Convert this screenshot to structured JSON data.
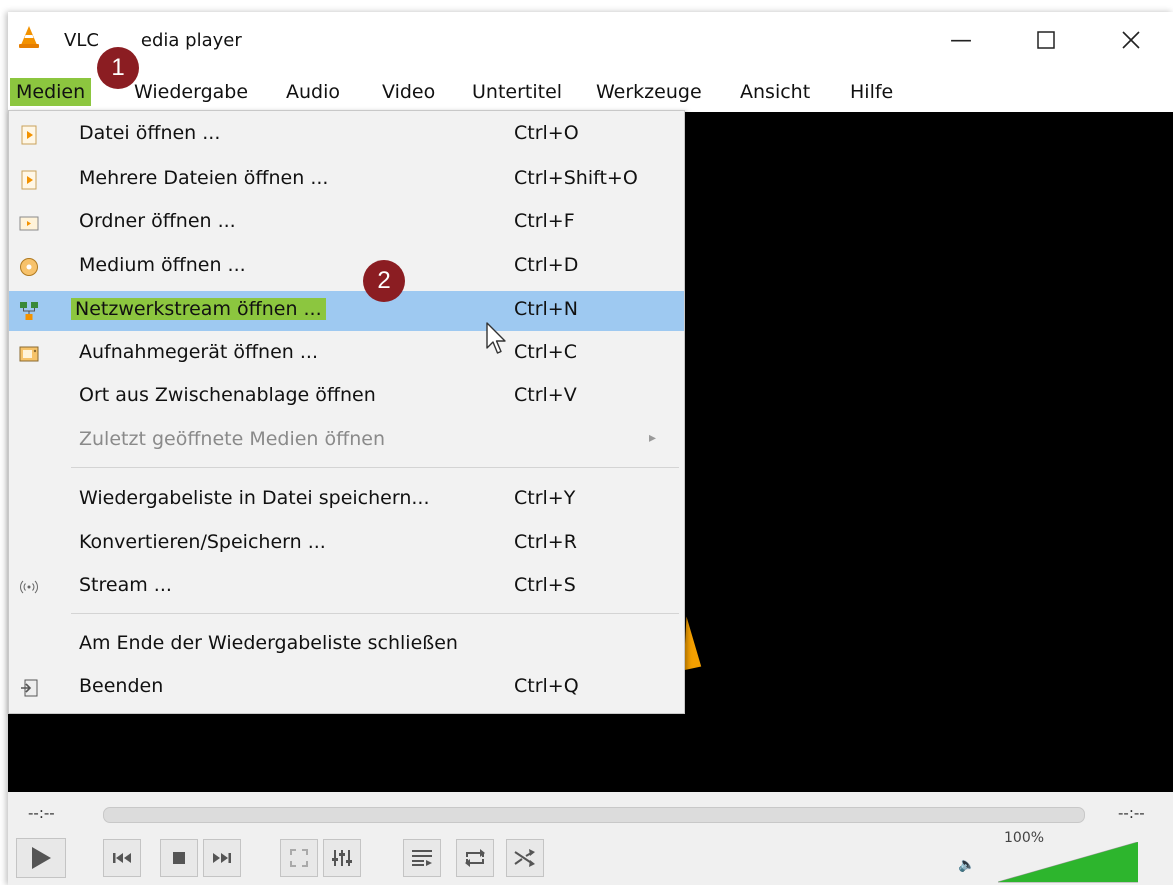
{
  "window": {
    "title": "VLC media player",
    "title_visible_left": "VLC",
    "title_visible_right": "edia player",
    "buttons": [
      "minimize-icon",
      "maximize-icon",
      "close-icon"
    ]
  },
  "menubar": {
    "items": [
      {
        "label": "Medien",
        "active": true
      },
      {
        "label": "Wiedergabe"
      },
      {
        "label": "Audio"
      },
      {
        "label": "Video"
      },
      {
        "label": "Untertitel"
      },
      {
        "label": "Werkzeuge"
      },
      {
        "label": "Ansicht"
      },
      {
        "label": "Hilfe"
      }
    ]
  },
  "menu": {
    "items": [
      {
        "label": "Datei öffnen ...",
        "shortcut": "Ctrl+O",
        "icon": "file-open-icon"
      },
      {
        "label": "Mehrere Dateien öffnen ...",
        "shortcut": "Ctrl+Shift+O",
        "icon": "files-open-icon"
      },
      {
        "label": "Ordner öffnen ...",
        "shortcut": "Ctrl+F",
        "icon": "folder-icon"
      },
      {
        "label": "Medium öffnen ...",
        "shortcut": "Ctrl+D",
        "icon": "disc-icon"
      },
      {
        "label": "Netzwerkstream öffnen ...",
        "shortcut": "Ctrl+N",
        "icon": "network-icon",
        "highlighted": true
      },
      {
        "label": "Aufnahmegerät öffnen ...",
        "shortcut": "Ctrl+C",
        "icon": "capture-device-icon"
      },
      {
        "label": "Ort aus Zwischenablage öffnen",
        "shortcut": "Ctrl+V"
      },
      {
        "label": "Zuletzt geöffnete Medien öffnen",
        "shortcut": "",
        "disabled": true,
        "submenu": true
      },
      {
        "label": "Wiedergabeliste in Datei speichern...",
        "shortcut": "Ctrl+Y"
      },
      {
        "label": "Konvertieren/Speichern ...",
        "shortcut": "Ctrl+R"
      },
      {
        "label": "Stream ...",
        "shortcut": "Ctrl+S",
        "icon": "stream-icon"
      },
      {
        "label": "Am Ende der Wiedergabeliste schließen",
        "shortcut": ""
      },
      {
        "label": "Beenden",
        "shortcut": "Ctrl+Q",
        "icon": "exit-icon"
      }
    ]
  },
  "badges": {
    "step1": "1",
    "step2": "2"
  },
  "controls": {
    "time_elapsed": "--:--",
    "time_total": "--:--",
    "volume": "100%",
    "volume_level": 1.0
  },
  "colors": {
    "highlight_green": "#8cc63f",
    "menu_hover": "#9ec9f1",
    "badge": "#8b1d22",
    "vlc_orange": "#f5a000"
  }
}
